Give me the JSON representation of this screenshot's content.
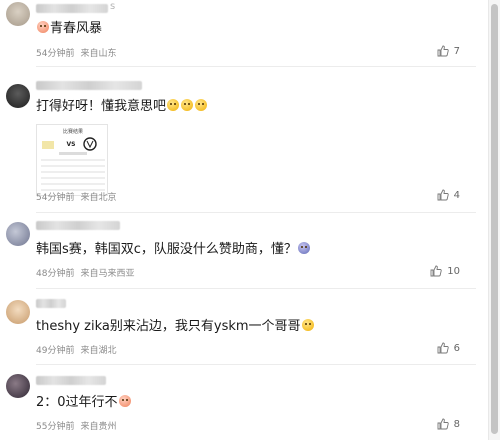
{
  "comments": [
    {
      "name_tail": "s",
      "text": "青春风暴",
      "leading_emoji": "grin-emoji",
      "trailing_emojis": [],
      "time": "54分钟前",
      "location": "来自山东",
      "likes": "7",
      "has_image": false
    },
    {
      "name_tail": "",
      "text": "打得好呀！懂我意思吧",
      "leading_emoji": "",
      "trailing_emojis": [
        "smirk-emoji",
        "smirk-emoji",
        "smirk-emoji"
      ],
      "time": "54分钟前",
      "location": "来自北京",
      "likes": "4",
      "has_image": true,
      "image": {
        "header": "比赛结果",
        "vs": "VS"
      }
    },
    {
      "name_tail": "",
      "text": "韩国s赛，韩国双c，队服没什么赞助商，懂？",
      "leading_emoji": "",
      "trailing_emojis": [
        "sly-emoji"
      ],
      "time": "48分钟前",
      "location": "来自马来西亚",
      "likes": "10",
      "has_image": false
    },
    {
      "name_tail": "",
      "text": "theshy zika别来沾边，我只有yskm一个哥哥",
      "leading_emoji": "",
      "trailing_emojis": [
        "proud-emoji"
      ],
      "time": "49分钟前",
      "location": "来自湖北",
      "likes": "6",
      "has_image": false
    },
    {
      "name_tail": "",
      "text": "2：0过年行不",
      "leading_emoji": "",
      "trailing_emojis": [
        "heart-eyes-emoji"
      ],
      "time": "55分钟前",
      "location": "来自贵州",
      "likes": "8",
      "has_image": false
    }
  ],
  "colors": {
    "meta": "#8a8a8a",
    "text": "#1a1a1a",
    "divider": "#ececec"
  }
}
